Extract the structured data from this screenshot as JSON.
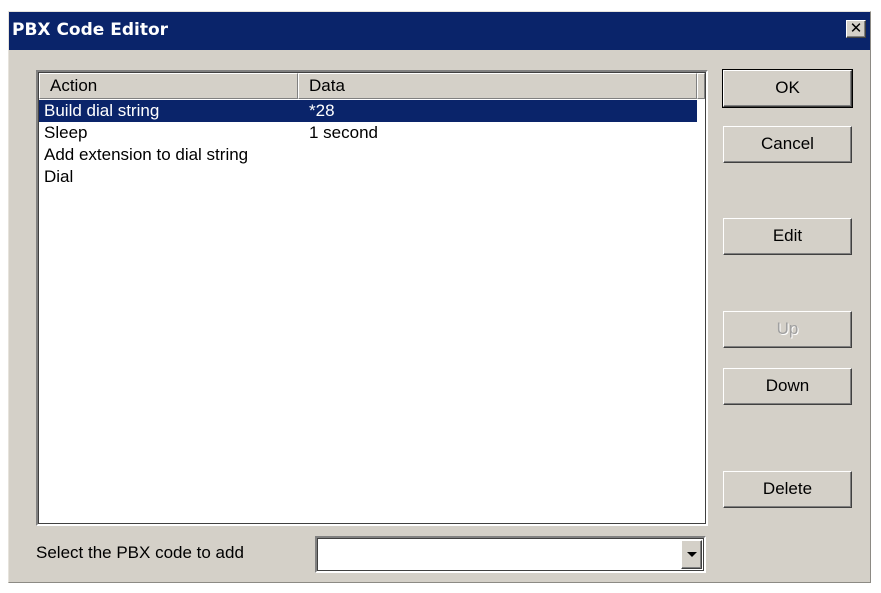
{
  "window": {
    "title": "PBX Code Editor",
    "close_glyph": "✕"
  },
  "list": {
    "columns": [
      "Action",
      "Data"
    ],
    "rows": [
      {
        "action": "Build dial string",
        "data": "*28",
        "selected": true
      },
      {
        "action": "Sleep",
        "data": "1 second",
        "selected": false
      },
      {
        "action": "Add extension to dial string",
        "data": "",
        "selected": false
      },
      {
        "action": "Dial",
        "data": "",
        "selected": false
      }
    ]
  },
  "buttons": {
    "ok": "OK",
    "cancel": "Cancel",
    "edit": "Edit",
    "up": "Up",
    "down": "Down",
    "delete": "Delete"
  },
  "add_code": {
    "label": "Select the PBX code to add",
    "value": ""
  },
  "colors": {
    "titlebar": "#0a246a",
    "face": "#d4d0c8",
    "selection": "#0a246a"
  }
}
